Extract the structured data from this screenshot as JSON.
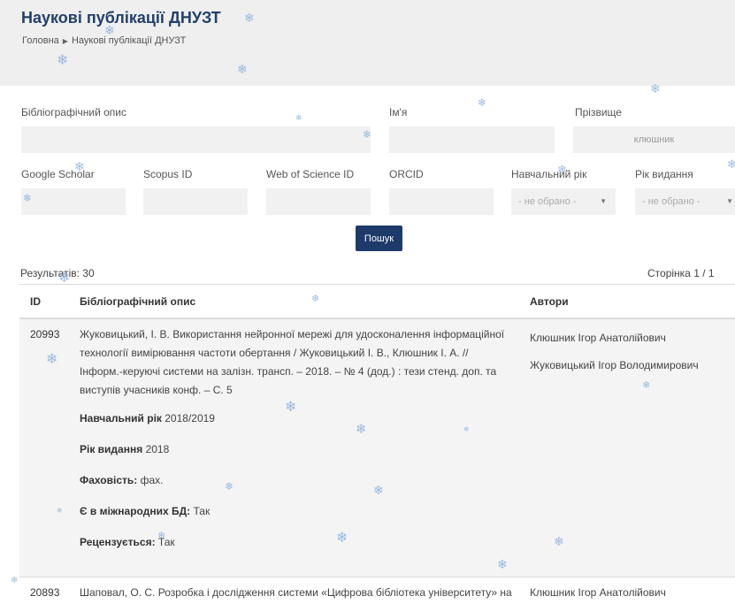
{
  "header": {
    "title": "Наукові публікації ДНУЗТ",
    "breadcrumb": {
      "home": "Головна",
      "current": "Наукові публікації ДНУЗТ"
    }
  },
  "filters": {
    "bibliographic_label": "Бібліографічний опис",
    "bibliographic_value": "",
    "first_name_label": "Ім'я",
    "first_name_value": "",
    "last_name_label": "Прізвище",
    "last_name_value": "клюшник",
    "google_scholar_label": "Google Scholar",
    "scopus_label": "Scopus ID",
    "wos_label": "Web of Science ID",
    "orcid_label": "ORCID",
    "academic_year_label": "Навчальний рік",
    "academic_year_value": "- не обрано -",
    "pub_year_label": "Рік видання",
    "pub_year_value": "- не обрано -",
    "search_button": "Пошук"
  },
  "results": {
    "count_text": "Результатів: 30",
    "page_text": "Сторінка 1 / 1",
    "columns": {
      "id": "ID",
      "description": "Бібліографічний опис",
      "authors": "Автори"
    },
    "rows": [
      {
        "id": "20993",
        "description": "Жуковицький, І. В. Використання нейронної мережі для удосконалення інформаційної технології вимірювання частоти обертання / Жуковицький І. В., Клюшник І. А. // Інформ.-керуючі системи на залізн. трансп. – 2018. – № 4 (дод.) : тези стенд. доп. та виступів учасників конф. – С. 5",
        "academic_year_label": "Навчальний рік",
        "academic_year": "2018/2019",
        "pub_year_label": "Рік видання",
        "pub_year": "2018",
        "specialty_label": "Фаховість:",
        "specialty": "фах.",
        "intl_db_label": "Є в міжнародних БД:",
        "intl_db": "Так",
        "reviewed_label": "Рецензується:",
        "reviewed": "Так",
        "authors": [
          "Клюшник Ігор Анатолійович",
          "Жуковицький Ігор Володимирович"
        ]
      },
      {
        "id": "20893",
        "description": "Шаповал, О. С. Розробка і дослідження системи «Цифрова бібліотека університету» на",
        "authors": [
          "Клюшник Ігор Анатолійович"
        ]
      }
    ]
  },
  "decor": {
    "flake_color": "#7aa6d6",
    "accent_color": "#1e3a6a",
    "flake_glyph": "❄"
  }
}
